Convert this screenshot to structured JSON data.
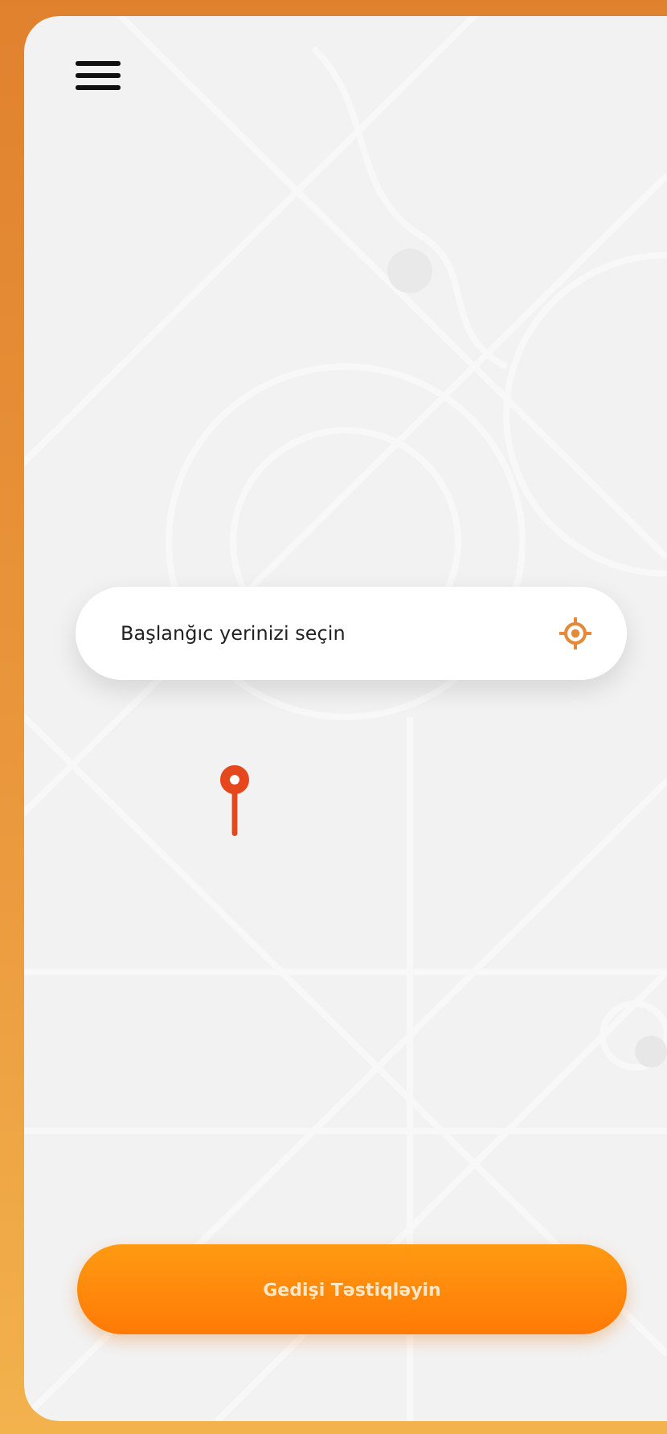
{
  "location_field": {
    "placeholder": "Başlanğıc yerinizi seçin"
  },
  "confirm_button": {
    "label": "Gedişi Təstiqləyin"
  }
}
